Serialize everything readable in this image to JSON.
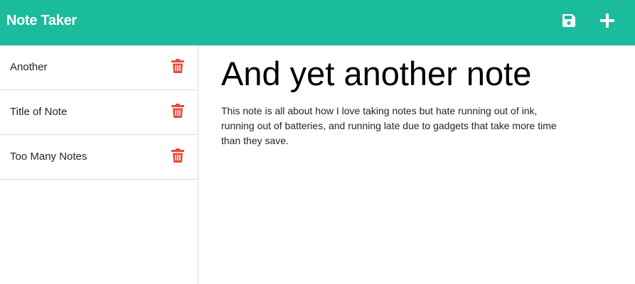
{
  "navbar": {
    "brand": "Note Taker",
    "save_icon": "floppy-disk-icon",
    "new_icon": "plus-icon",
    "bg_color": "#1abc9c"
  },
  "sidebar": {
    "notes": [
      {
        "title": "Another",
        "delete_icon": "trash-icon"
      },
      {
        "title": "Title of Note",
        "delete_icon": "trash-icon"
      },
      {
        "title": "Too Many Notes",
        "delete_icon": "trash-icon"
      }
    ],
    "delete_color": "#e74c3c"
  },
  "main": {
    "title": "And yet another note",
    "body": "This note is all about how I love taking notes but hate running out of ink, running out of batteries, and running late due to gadgets that take more time than they save."
  }
}
